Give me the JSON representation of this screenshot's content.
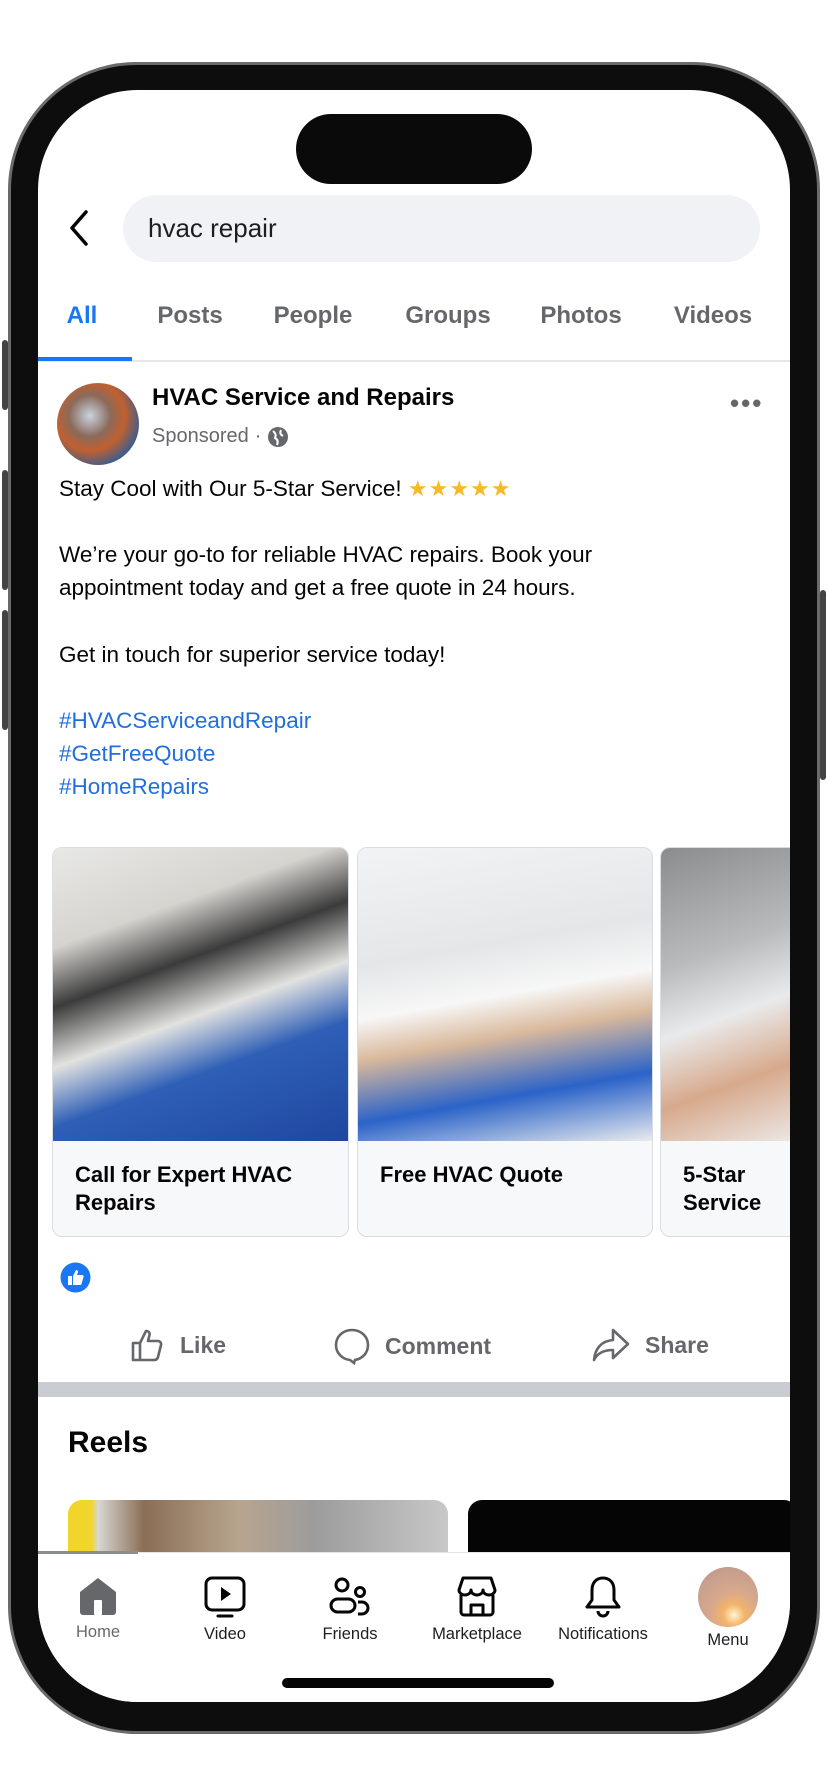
{
  "search": {
    "query": "hvac repair"
  },
  "tabs": [
    {
      "label": "All",
      "active": true
    },
    {
      "label": "Posts"
    },
    {
      "label": "People"
    },
    {
      "label": "Groups"
    },
    {
      "label": "Photos"
    },
    {
      "label": "Videos"
    }
  ],
  "post": {
    "page_name": "HVAC Service and Repairs",
    "sponsored": "Sponsored",
    "separator": "·",
    "headline": "Stay Cool with Our 5-Star Service!",
    "stars": "★★★★★",
    "paragraph": "We’re your go-to for reliable HVAC repairs. Book your appointment today and get a free quote in 24 hours.",
    "cta_line": "Get in touch for superior service today!",
    "hashtags": [
      "#HVACServiceandRepair",
      "#GetFreeQuote",
      "#HomeRepairs"
    ],
    "cards": [
      {
        "title": "Call for Expert HVAC Repairs"
      },
      {
        "title": "Free HVAC Quote"
      },
      {
        "title": "5-Star Service"
      }
    ],
    "actions": {
      "like": "Like",
      "comment": "Comment",
      "share": "Share"
    }
  },
  "reels": {
    "title": "Reels"
  },
  "bottom_nav": [
    {
      "label": "Home",
      "icon": "home-icon",
      "active": true
    },
    {
      "label": "Video",
      "icon": "video-icon"
    },
    {
      "label": "Friends",
      "icon": "friends-icon"
    },
    {
      "label": "Marketplace",
      "icon": "marketplace-icon"
    },
    {
      "label": "Notifications",
      "icon": "bell-icon"
    },
    {
      "label": "Menu",
      "icon": "profile-avatar"
    }
  ],
  "colors": {
    "accent": "#1877f2",
    "hashtag": "#216fdb",
    "muted": "#65676b",
    "star": "#f7b928"
  }
}
